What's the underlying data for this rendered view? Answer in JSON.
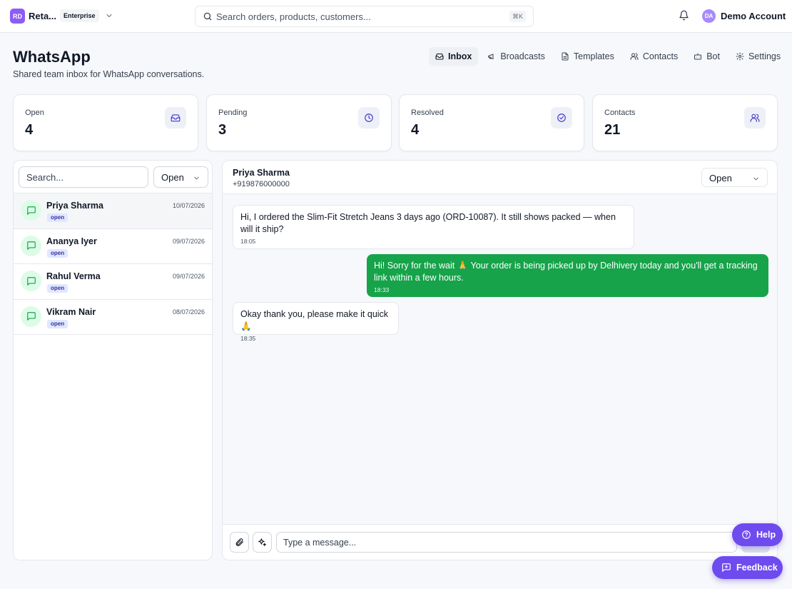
{
  "topbar": {
    "logo_initials": "RD",
    "org_name": "Reta...",
    "org_plan": "Enterprise",
    "search_placeholder": "Search orders, products, customers...",
    "search_shortcut": "⌘K",
    "user_initials": "DA",
    "user_name": "Demo Account"
  },
  "header": {
    "title": "WhatsApp",
    "subtitle": "Shared team inbox for WhatsApp conversations.",
    "tabs": [
      {
        "label": "Inbox",
        "icon": "inbox-icon",
        "active": true
      },
      {
        "label": "Broadcasts",
        "icon": "megaphone-icon"
      },
      {
        "label": "Templates",
        "icon": "file-text-icon"
      },
      {
        "label": "Contacts",
        "icon": "users-icon"
      },
      {
        "label": "Bot",
        "icon": "bot-icon"
      },
      {
        "label": "Settings",
        "icon": "gear-icon"
      }
    ]
  },
  "stats": [
    {
      "label": "Open",
      "value": "4",
      "icon": "inbox-icon"
    },
    {
      "label": "Pending",
      "value": "3",
      "icon": "clock-icon"
    },
    {
      "label": "Resolved",
      "value": "4",
      "icon": "check-circle-icon"
    },
    {
      "label": "Contacts",
      "value": "21",
      "icon": "users-icon"
    }
  ],
  "list": {
    "search_placeholder": "Search...",
    "filter_value": "Open",
    "conversations": [
      {
        "name": "Priya Sharma",
        "status": "open",
        "date": "10/07/2026",
        "active": true
      },
      {
        "name": "Ananya Iyer",
        "status": "open",
        "date": "09/07/2026"
      },
      {
        "name": "Rahul Verma",
        "status": "open",
        "date": "09/07/2026"
      },
      {
        "name": "Vikram Nair",
        "status": "open",
        "date": "08/07/2026"
      }
    ]
  },
  "chat": {
    "contact_name": "Priya Sharma",
    "contact_phone": "+919876000000",
    "status_value": "Open",
    "messages": [
      {
        "direction": "in",
        "text": "Hi, I ordered the Slim-Fit Stretch Jeans 3 days ago (ORD-10087). It still shows packed — when will it ship?",
        "time": "18:05"
      },
      {
        "direction": "out",
        "text": "Hi! Sorry for the wait 🙏 Your order is being picked up by Delhivery today and you'll get a tracking link within a few hours.",
        "time": "18:33"
      },
      {
        "direction": "in",
        "text": "Okay thank you, please make it quick 🙏",
        "time": "18:35"
      }
    ],
    "composer_placeholder": "Type a message..."
  },
  "floating": {
    "help_label": "Help",
    "feedback_label": "Feedback"
  },
  "colors": {
    "brand": "#6d4bef",
    "outgoing_bubble": "#16a34a",
    "status_badge_bg": "#e0e7ff",
    "avatar_bg": "#dcfce7"
  }
}
